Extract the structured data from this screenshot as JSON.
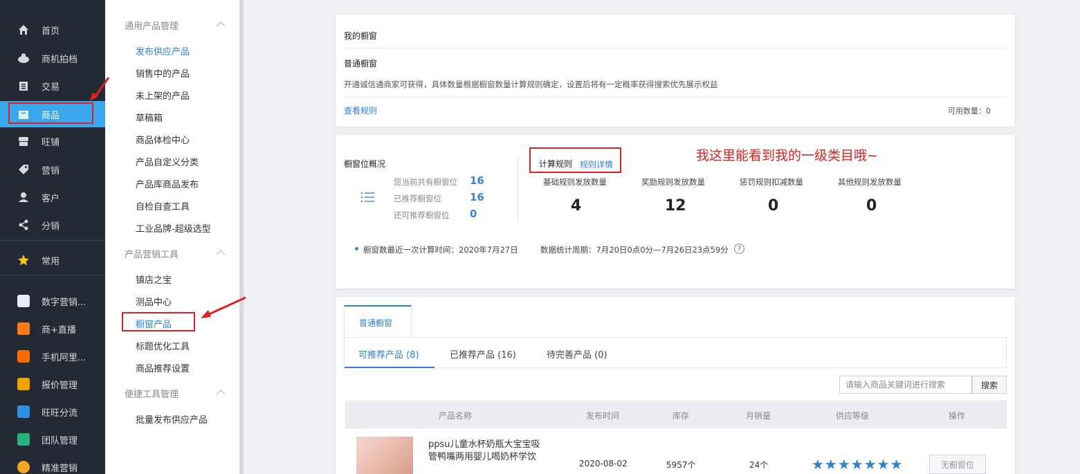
{
  "nav": {
    "items": [
      {
        "label": "首页",
        "icon": "home-icon"
      },
      {
        "label": "商机拍档",
        "icon": "crown-icon"
      },
      {
        "label": "交易",
        "icon": "clipboard-icon"
      },
      {
        "label": "商品",
        "icon": "bag-icon"
      },
      {
        "label": "旺铺",
        "icon": "store-icon"
      },
      {
        "label": "营销",
        "icon": "tag-icon"
      },
      {
        "label": "客户",
        "icon": "user-icon"
      },
      {
        "label": "分销",
        "icon": "share-icon"
      }
    ],
    "common": {
      "label": "常用",
      "icon": "star-icon"
    },
    "apps": [
      {
        "label": "数字营销...",
        "color": "#e8ecf6"
      },
      {
        "label": "商+直播",
        "color": "#ff7a1a"
      },
      {
        "label": "手机阿里...",
        "color": "#ff6a00"
      },
      {
        "label": "报价管理",
        "color": "#f0a400"
      },
      {
        "label": "旺旺分流",
        "color": "#2f8fe3"
      },
      {
        "label": "团队管理",
        "color": "#26b37a"
      },
      {
        "label": "精准营销",
        "color": "#f5a623"
      }
    ]
  },
  "subnav": {
    "groups": [
      {
        "title": "通用产品管理",
        "items": [
          "发布供应产品",
          "销售中的产品",
          "未上架的产品",
          "草稿箱",
          "商品体检中心",
          "产品自定义分类",
          "产品库商品发布",
          "自检自查工具",
          "工业品牌-超级选型"
        ]
      },
      {
        "title": "产品营销工具",
        "items": [
          "镇店之宝",
          "测品中心",
          "橱窗产品",
          "标题优化工具",
          "商品推荐设置"
        ]
      },
      {
        "title": "便捷工具管理",
        "items": [
          "批量发布供应产品"
        ]
      }
    ]
  },
  "my_window": {
    "title": "我的橱窗",
    "subtitle": "普通橱窗",
    "desc": "开通诚信通商家可获得，具体数量根据橱窗数量计算规则确定，设置后将有一定概率获得搜索优先展示权益",
    "rules_link": "查看规则",
    "available": "可用数量：0"
  },
  "overview": {
    "title": "橱窗位概况",
    "stats": [
      {
        "label": "您当前共有橱窗位",
        "value": "16"
      },
      {
        "label": "已推荐橱窗位",
        "value": "16"
      },
      {
        "label": "还可推荐橱窗位",
        "value": "0"
      }
    ],
    "calc_title": "计算规则",
    "calc_link": "规则详情",
    "annotation": "我这里能看到我的一级类目哦~",
    "metrics": [
      {
        "label": "基础规则发放数量",
        "value": "4"
      },
      {
        "label": "奖励规则发放数量",
        "value": "12"
      },
      {
        "label": "惩罚规则扣减数量",
        "value": "0"
      },
      {
        "label": "其他规则发放数量",
        "value": "0"
      }
    ],
    "last_calc": "橱窗数最近一次计算时间：2020年7月27日",
    "period": "数据统计周期：7月20日0点0分—7月26日23点59分"
  },
  "products": {
    "tab": "普通橱窗",
    "subtabs": [
      "可推荐产品 (8)",
      "已推荐产品 (16)",
      "待完善产品 (0)"
    ],
    "search_placeholder": "请输入商品关键词进行搜索",
    "search_btn": "搜索",
    "columns": [
      "产品名称",
      "发布时间",
      "库存",
      "月销量",
      "供应等级",
      "操作"
    ],
    "rows": [
      {
        "name_line1": "ppsu儿童水杯奶瓶大宝宝吸",
        "name_line2": "管鸭嘴两用婴儿喝奶杯学饮",
        "date": "2020-08-02",
        "stock": "5957个",
        "sales": "24个",
        "stars": "★★★★★★★",
        "action": "无橱窗位"
      }
    ]
  }
}
